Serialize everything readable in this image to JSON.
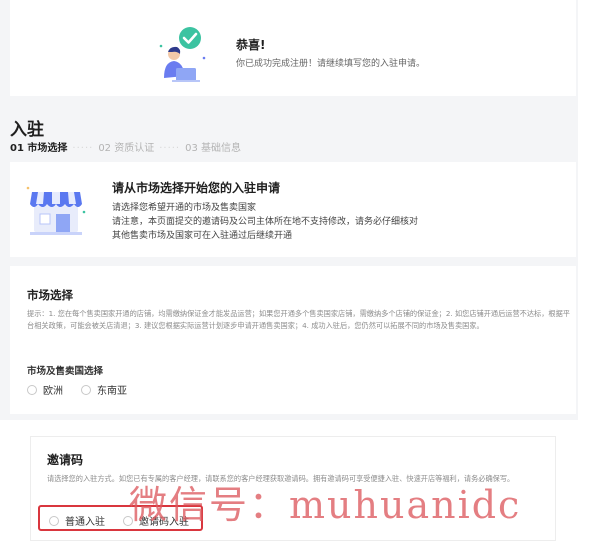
{
  "congrats": {
    "title": "恭喜!",
    "subtitle": "你已成功完成注册！请继续填写您的入驻申请。"
  },
  "page": {
    "title": "入驻",
    "steps": [
      {
        "label": "01 市场选择",
        "active": true
      },
      {
        "label": "02 资质认证",
        "active": false
      },
      {
        "label": "03 基础信息",
        "active": false
      }
    ]
  },
  "intro": {
    "title": "请从市场选择开始您的入驻申请",
    "lines": [
      "请选择您希望开通的市场及售卖国家",
      "请注意，本页面提交的邀请码及公司主体所在地不支持修改，请务必仔细核对",
      "其他售卖市场及国家可在入驻通过后继续开通"
    ]
  },
  "market": {
    "title": "市场选择",
    "tip": "提示：1. 您在每个售卖国家开通的店铺，均需缴纳保证金才能发品运营；如果您开通多个售卖国家店铺，需缴纳多个店铺的保证金；2. 如您店铺开通后运营不达标，根据平台相关政策，可能会被关店清退；3. 建议您根据实际运营计划逐步申请开通售卖国家；4. 成功入驻后，您仍然可以拓展不同的市场及售卖国家。",
    "subtitle": "市场及售卖国选择",
    "options": [
      "欧洲",
      "东南亚"
    ]
  },
  "invite": {
    "title": "邀请码",
    "desc": "请选择您的入驻方式。如您已有专属的客户经理，请联系您的客户经理获取邀请码。拥有邀请码可享受便捷入驻、快速开店等福利，请务必确保写。",
    "options": [
      "普通入驻",
      "邀请码入驻"
    ]
  },
  "watermark": "微信号：muhuanidc",
  "colors": {
    "accent_green": "#3cc3a1",
    "highlight_red": "#d9363e",
    "background": "#f4f5f7"
  }
}
